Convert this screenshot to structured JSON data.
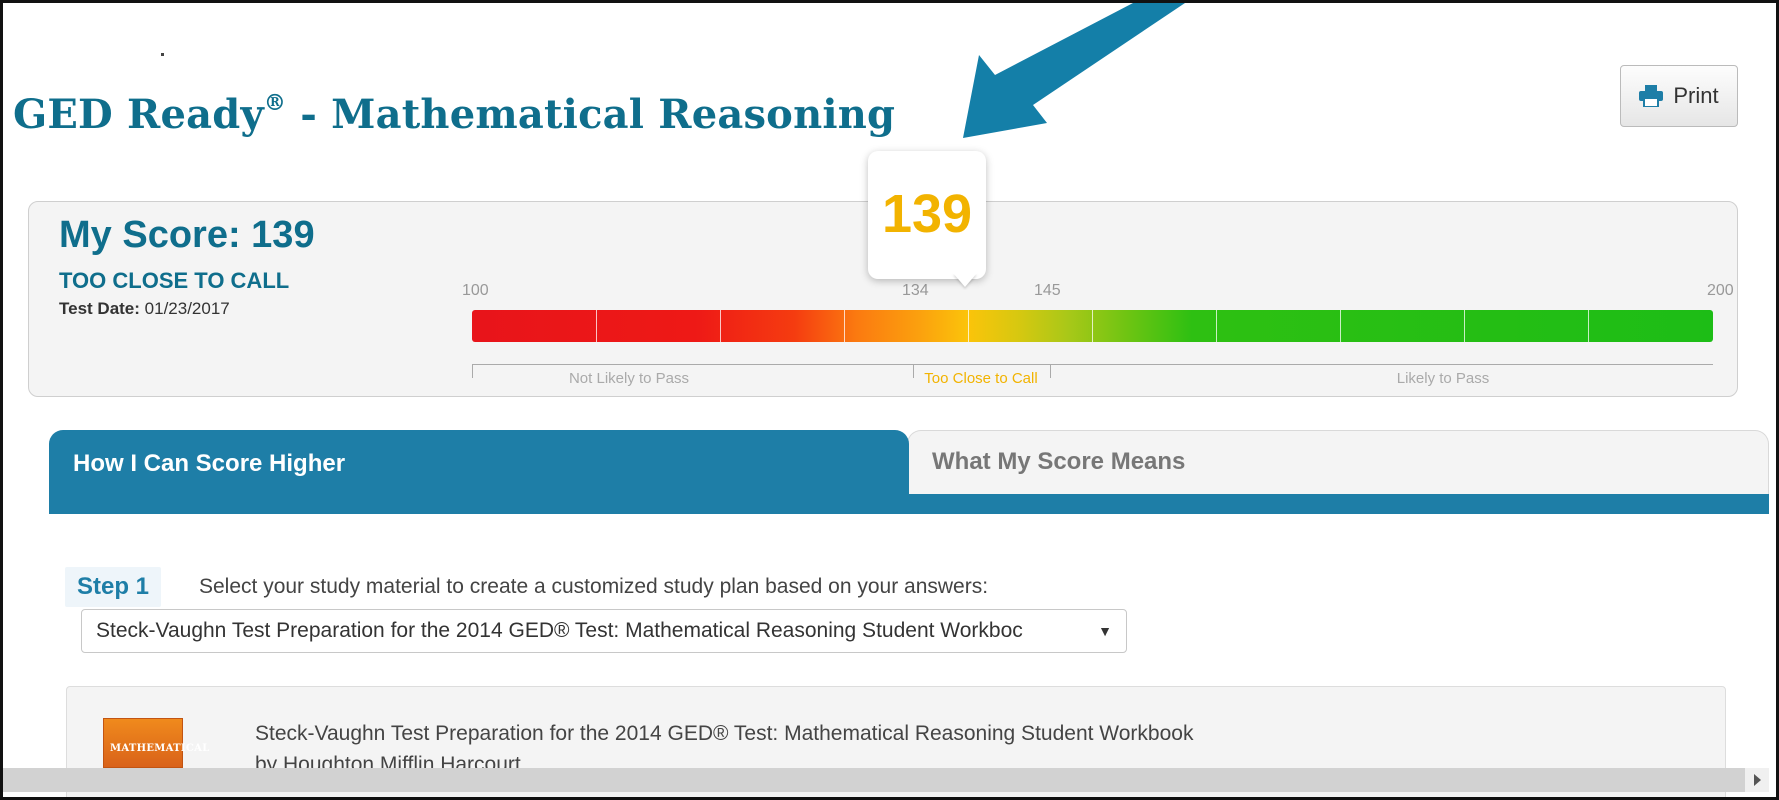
{
  "page": {
    "title": "GED Ready",
    "title_reg": "®",
    "title_suffix": " - Mathematical Reasoning",
    "print_label": "Print"
  },
  "score": {
    "heading": "My Score: 139",
    "status": "TOO CLOSE TO CALL",
    "test_date_label": "Test Date:",
    "test_date_value": "01/23/2017",
    "bubble_value": "139",
    "value": 139,
    "scale": {
      "min_label": "100",
      "low_cut_label": "134",
      "high_cut_label": "145",
      "max_label": "200"
    },
    "zones": {
      "low": "Not Likely to Pass",
      "mid": "Too Close to Call",
      "high": "Likely to Pass"
    }
  },
  "tabs": {
    "active": "How I Can Score Higher",
    "inactive": "What My Score Means"
  },
  "step": {
    "badge": "Step 1",
    "text": "Select your study material to create a customized study plan based on your answers:",
    "select_value": "Steck-Vaughn Test Preparation for the 2014 GED® Test: Mathematical Reasoning Student Workboc"
  },
  "book": {
    "cover_text": "MATHEMATICAL",
    "title": "Steck-Vaughn Test Preparation for the 2014 GED® Test: Mathematical Reasoning Student Workbook",
    "author": "by Houghton Mifflin Harcourt"
  },
  "colors": {
    "brand": "#0f6e8c",
    "tab": "#1e7ea7",
    "score_highlight": "#f2b300",
    "arrow": "#147fa8"
  },
  "icons": {
    "print": "printer-icon",
    "select": "dropdown-arrow-icon",
    "annotation": "pointer-arrow"
  }
}
